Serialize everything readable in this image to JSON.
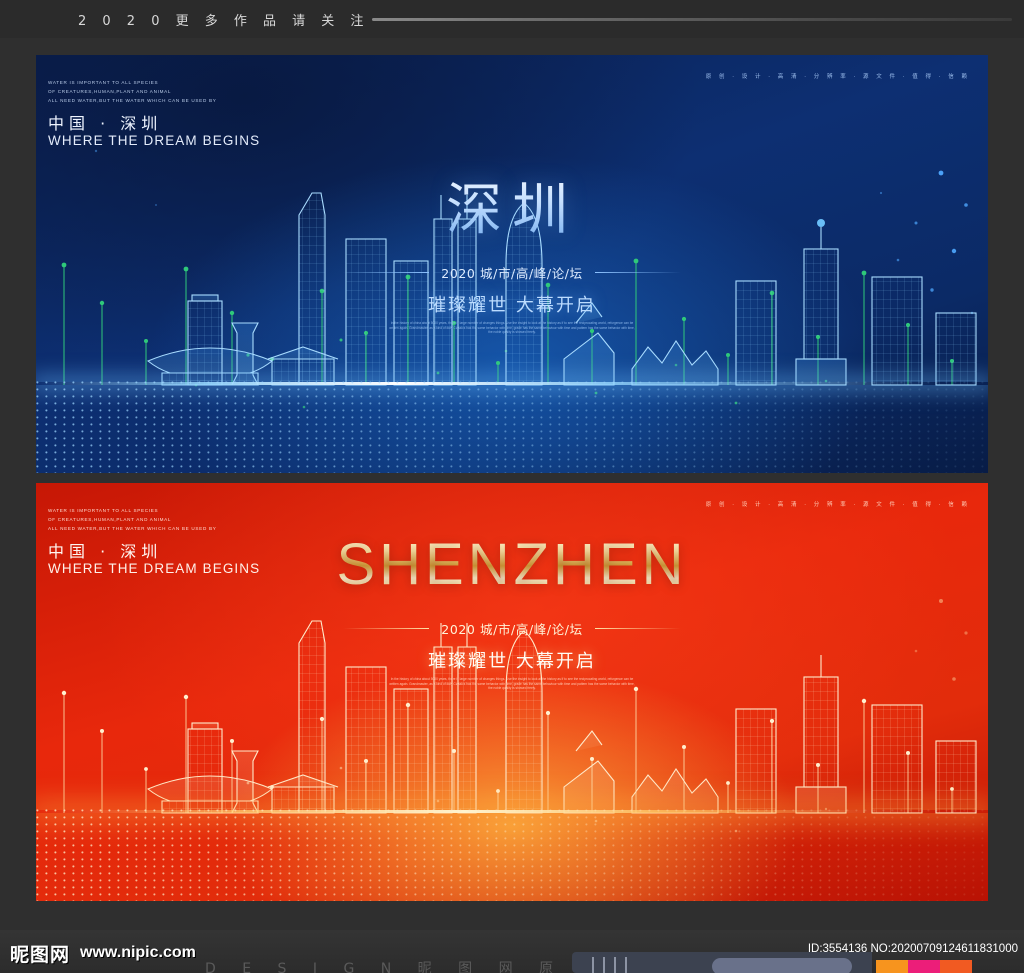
{
  "topbar": {
    "title": "2 0 2 0 更 多 作 品 请 关 注"
  },
  "banners": [
    {
      "id": "blue",
      "corner_text": [
        "WATER IS IMPORTANT TO ALL SPECIES",
        "OF CREATURES,HUMAN,PLANT AND ANIMAL",
        "ALL NEED WATER,BUT THE WATER WHICH CAN BE USED BY"
      ],
      "cn_city": "中国 · 深圳",
      "en_tagline": "WHERE THE DREAM BEGINS",
      "top_right_tag": "原 创 · 设 计 · 高 清 · 分 辨 率 · 源 文 件 · 值 得 · 信 赖",
      "big_title": "深圳",
      "sub_cn": "2020 城/市/高/峰/论/坛",
      "slogan": "璀璨耀世 大幕开启",
      "paragraph": "In the history of china about 5000 years, there is large number of changes things. Use the insight to look at the history as if to see the reciprocating world, refurgence can be written again. Grandmaster, as a kind of duty Classics has the same behavior with time, grade has the same behaviour with time and pattern has the same behavior with time, the noble quality is showed freely.",
      "accent": "#8dc2ff",
      "background": "#0b2a63"
    },
    {
      "id": "red",
      "corner_text": [
        "WATER IS IMPORTANT TO ALL SPECIES",
        "OF CREATURES,HUMAN,PLANT AND ANIMAL",
        "ALL NEED WATER,BUT THE WATER WHICH CAN BE USED BY"
      ],
      "cn_city": "中国 · 深圳",
      "en_tagline": "WHERE THE DREAM BEGINS",
      "top_right_tag": "原 创 · 设 计 · 高 清 · 分 辨 率 · 源 文 件 · 值 得 · 信 赖",
      "big_title": "SHENZHEN",
      "sub_cn": "2020 城/市/高/峰/论/坛",
      "slogan": "璀璨耀世 大幕开启",
      "paragraph": "In the history of china about 5000 years, there is large number of changes things. Use the insight to look at the history as if to see the reciprocating world, refurgence can be written again. Grandmaster, as a kind of duty Classics has the same behavior with time, grade has the same behaviour with time and pattern has the same behavior with time, the noble quality is showed freely.",
      "accent": "#ffe3a6",
      "background": "#d8200d"
    }
  ],
  "footer": {
    "watermark_logo": "昵图网",
    "watermark_url": "www.nipic.com",
    "design_line": "D E S I G N 昵 图 网 原 创",
    "id_text": "ID:3554136 NO:20200709124611831000",
    "swatches": [
      "#f7941e",
      "#ec1e79",
      "#f15a22"
    ]
  }
}
